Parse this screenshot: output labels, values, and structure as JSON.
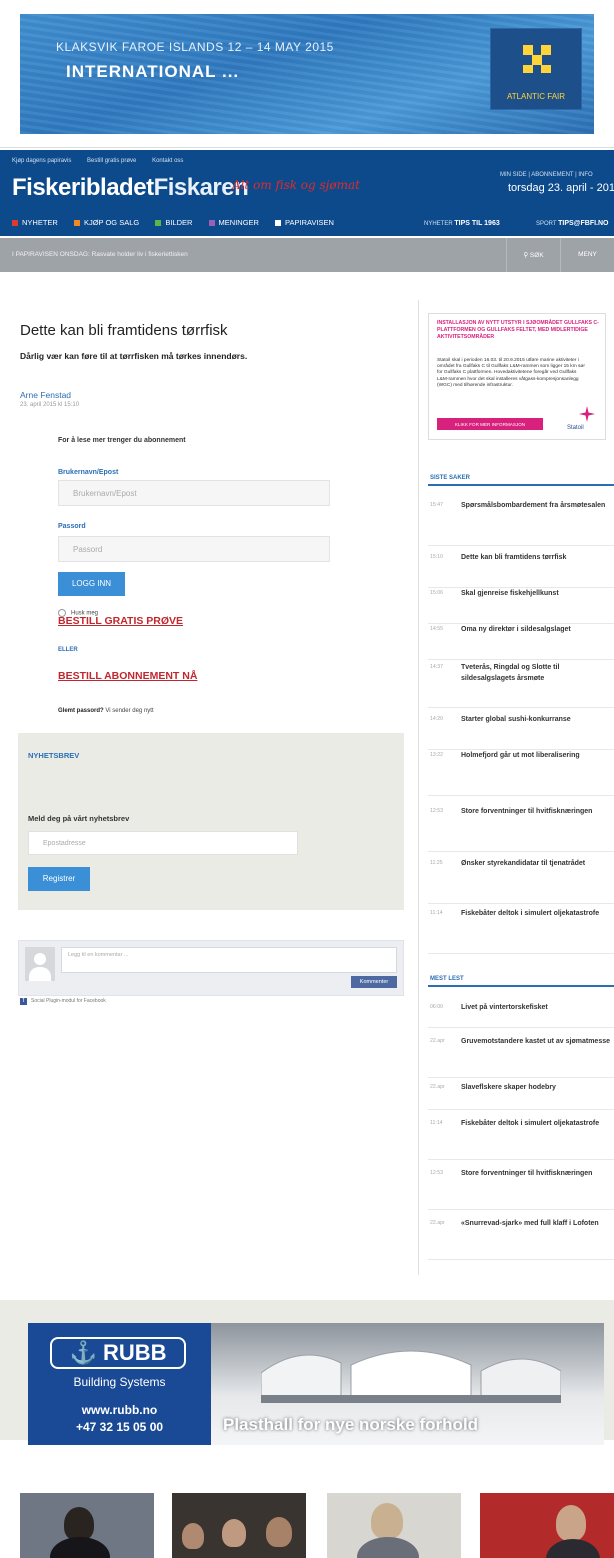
{
  "top_ad": {
    "event_line": "KLAKSVIK FAROE ISLANDS 12 – 14 MAY 2015",
    "brand": "INTERNATIONAL ...",
    "logo_text": "ATLANTIC FAIR"
  },
  "header": {
    "util_links": [
      "Kjøp dagens papiravis",
      "Bestill gratis prøve",
      "Kontakt oss"
    ],
    "logo_part1": "Fiskeribladet",
    "logo_part2": "Fiskaren",
    "slogan": "Alt om fisk og sjømat",
    "right_links": "MIN SIDE  |  ABONNEMENT  |  INFO",
    "date": "torsdag 23. april - 2015",
    "nav": [
      {
        "label": "NYHETER",
        "color": "#e03a2f"
      },
      {
        "label": "KJØP OG SALG",
        "color": "#f08a24"
      },
      {
        "label": "BILDER",
        "color": "#5fb446"
      },
      {
        "label": "MENINGER",
        "color": "#9b5fb5"
      },
      {
        "label": "PAPIRAVISEN",
        "color": "#ffffff"
      }
    ],
    "tips1_label": "NYHETER",
    "tips1_value": "TIPS TIL 1963",
    "tips2_label": "SPORT",
    "tips2_value": "TIPS@FBFI.NO"
  },
  "breaking": {
    "text": "I PAPIRAVISEN ONSDAG: Rasvate holder liv i fiskeriettisken",
    "search": "SØK",
    "menu": "MENY"
  },
  "article": {
    "title": "Dette kan bli framtidens tørrfisk",
    "lead": "Dårlig vær kan føre til at tørrfisken må tørkes innendørs.",
    "author": "Arne Fenstad",
    "timestamp": "23. april 2015 kl 15:10"
  },
  "login": {
    "intro": "For å lese mer trenger du abonnement",
    "user_label": "Brukernavn/Epost",
    "user_placeholder": "Brukernavn/Epost",
    "pass_label": "Passord",
    "pass_placeholder": "Passord",
    "login_button": "LOGG INN",
    "remember": "Husk meg",
    "trial_link": "BESTILL GRATIS PRØVE",
    "or": "ELLER",
    "subscribe_link": "BESTILL ABONNEMENT NÅ",
    "forgot_bold": "Glemt passord?",
    "forgot_rest": " Vi sender deg nytt"
  },
  "newsletter": {
    "title": "NYHETSBREV",
    "lead": "Meld deg på vårt nyhetsbrev",
    "placeholder": "Epostadresse",
    "button": "Registrer"
  },
  "comments": {
    "placeholder": "Legg til en kommentar ...",
    "button": "Kommenter",
    "plugin": "Social Plugin-modul for Facebook"
  },
  "side_ad": {
    "headline": "INSTALLASJON AV NYTT UTSTYR I SJØOMRÅDET GULLFAKS C-PLATTFORMEN OG GULLFAKS FELTET, MED MIDLERTIDIGE AKTIVITETSOMRÅDER",
    "body": "Statoil skal i perioden 16.03. til 20.9.2015 utføre marine aktiviteter i området fra Gullfaks C til Gullfaks L&M-rammen som ligger 15 km sør for Gullfaks C plattformen. Hovedaktivitetene foregår ved Gullfaks L&M-rammen hvor det skal installeres våtgass-kompresjonsanlegg (WGC) med tilhørende infrastruktur.",
    "cta": "KLIKK FOR MER INFORMASJON",
    "brand": "Statoil"
  },
  "siste_saker": {
    "title": "SISTE SAKER",
    "items": [
      {
        "time": "15:47",
        "headline": "Spørsmålsbombardement fra årsmøtesalen"
      },
      {
        "time": "15:10",
        "headline": "Dette kan bli framtidens tørrfisk"
      },
      {
        "time": "15:06",
        "headline": "Skal gjenreise fiskehjellkunst"
      },
      {
        "time": "14:55",
        "headline": "Oma ny direktør i sildesalgslaget"
      },
      {
        "time": "14:37",
        "headline": "Tveterås, Ringdal og Slotte til sildesalgslagets årsmøte"
      },
      {
        "time": "14:20",
        "headline": "Starter global sushi-konkurranse"
      },
      {
        "time": "13:22",
        "headline": "Holmefjord går ut mot liberalisering"
      },
      {
        "time": "12:53",
        "headline": "Store forventninger til hvitfisknæringen"
      },
      {
        "time": "11:25",
        "headline": "Ønsker styrekandidatar til tjenatrådet"
      },
      {
        "time": "11:14",
        "headline": "Fiskebåter deltok i simulert oljekatastrofe"
      }
    ]
  },
  "mest_lest": {
    "title": "MEST LEST",
    "items": [
      {
        "time": "06:00",
        "headline": "Livet på vintertorskefisket"
      },
      {
        "time": "22.apr",
        "headline": "Gruvemotstandere kastet ut av sjømatmesse"
      },
      {
        "time": "22.apr",
        "headline": "Slaveflskere skaper hodebry"
      },
      {
        "time": "11:14",
        "headline": "Fiskebåter deltok i simulert oljekatastrofe"
      },
      {
        "time": "12:53",
        "headline": "Store forventninger til hvitfisknæringen"
      },
      {
        "time": "22.apr",
        "headline": "«Snurrevad-sjark» med full klaff i Lofoten"
      }
    ]
  },
  "bottom_ad": {
    "brand": "RUBB",
    "sub": "Building Systems",
    "url": "www.rubb.no",
    "phone": "+47 32 15 05 00",
    "tagline": "Plasthall for nye norske forhold"
  },
  "thumbnails": [
    "speaker",
    "audience",
    "woman",
    "man"
  ]
}
